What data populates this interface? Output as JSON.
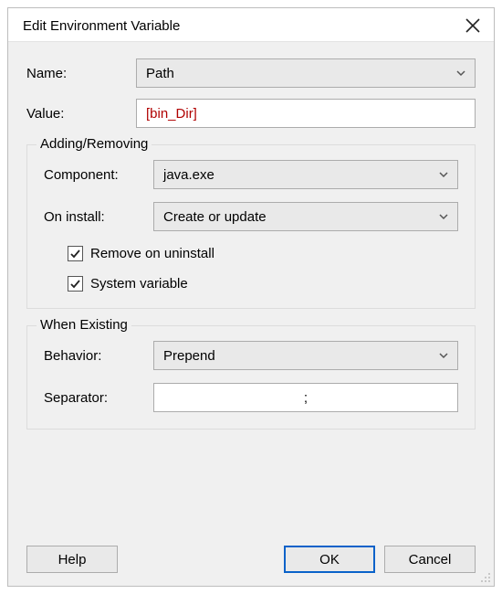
{
  "title": "Edit Environment Variable",
  "name_label": "Name:",
  "name_value": "Path",
  "value_label": "Value:",
  "value_value": "[bin_Dir]",
  "group_add_remove": {
    "legend": "Adding/Removing",
    "component_label": "Component:",
    "component_value": "java.exe",
    "on_install_label": "On install:",
    "on_install_value": "Create or update",
    "remove_label": "Remove on uninstall",
    "system_label": "System variable"
  },
  "group_when_existing": {
    "legend": "When Existing",
    "behavior_label": "Behavior:",
    "behavior_value": "Prepend",
    "separator_label": "Separator:",
    "separator_value": ";"
  },
  "buttons": {
    "help": "Help",
    "ok": "OK",
    "cancel": "Cancel"
  }
}
